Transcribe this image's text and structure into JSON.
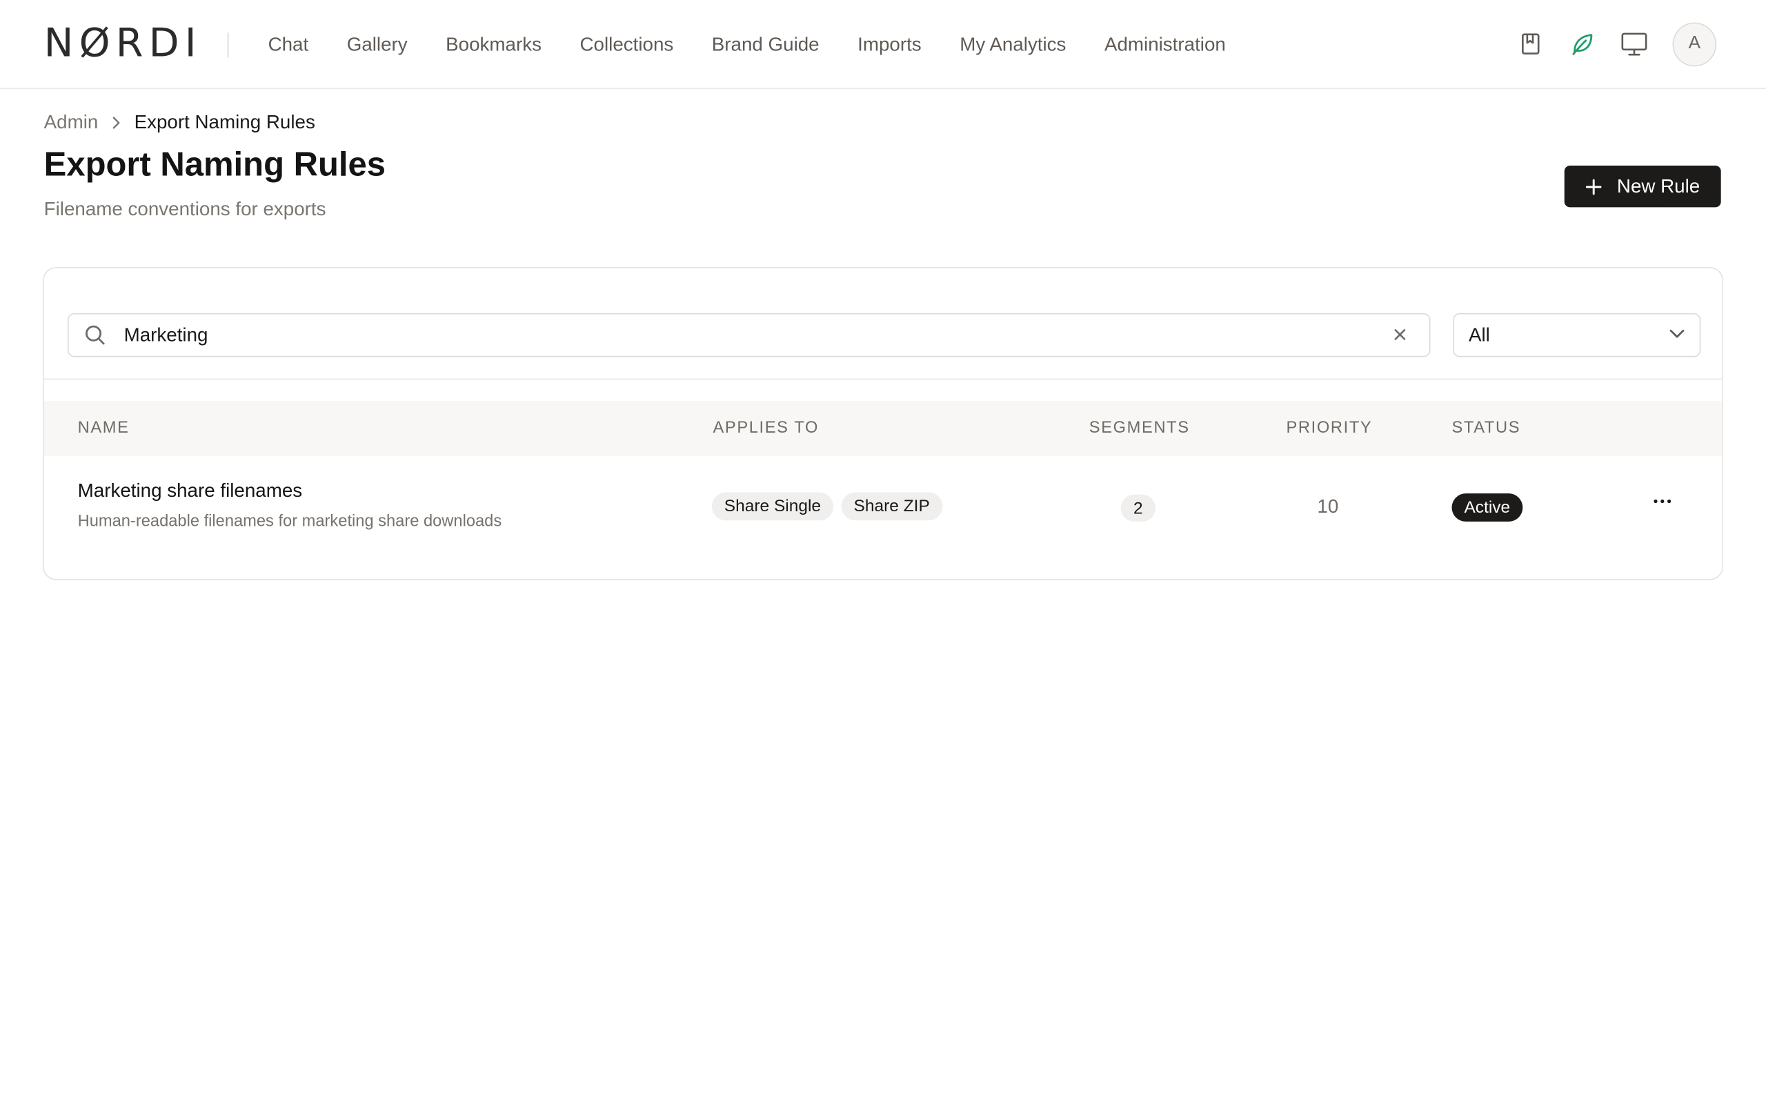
{
  "brand": {
    "logo_text": "NØRDI",
    "accent": "#1f9d6b"
  },
  "nav": {
    "items": [
      {
        "label": "Chat"
      },
      {
        "label": "Gallery"
      },
      {
        "label": "Bookmarks"
      },
      {
        "label": "Collections"
      },
      {
        "label": "Brand Guide"
      },
      {
        "label": "Imports"
      },
      {
        "label": "My Analytics"
      },
      {
        "label": "Administration"
      }
    ]
  },
  "header_icons": [
    "bookmark-icon",
    "leaf-icon",
    "monitor-icon"
  ],
  "user": {
    "avatar_initial": "A"
  },
  "breadcrumb": {
    "parent": "Admin",
    "current": "Export Naming Rules"
  },
  "page": {
    "title": "Export Naming Rules",
    "subtitle": "Filename conventions for exports",
    "new_button_label": "New Rule"
  },
  "filters": {
    "search_value": "Marketing",
    "status_selected": "All"
  },
  "table": {
    "columns": {
      "name": "NAME",
      "applies_to": "APPLIES TO",
      "segments": "SEGMENTS",
      "priority": "PRIORITY",
      "status": "STATUS"
    },
    "rows": [
      {
        "name": "Marketing share filenames",
        "description": "Human-readable filenames for marketing share downloads",
        "applies_to": [
          "Share Single",
          "Share ZIP"
        ],
        "segments": "2",
        "priority": "10",
        "status": "Active"
      }
    ]
  }
}
